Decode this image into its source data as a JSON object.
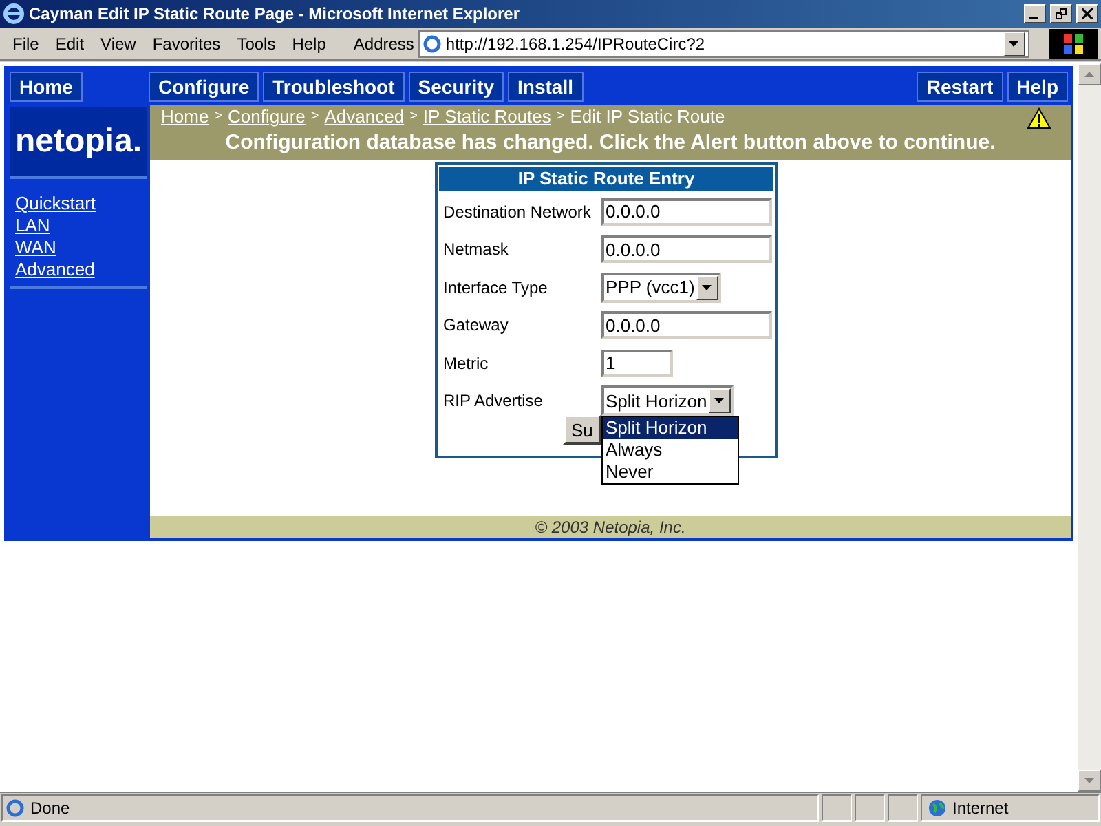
{
  "window": {
    "title": "Cayman Edit IP Static Route Page - Microsoft Internet Explorer"
  },
  "menu": [
    "File",
    "Edit",
    "View",
    "Favorites",
    "Tools",
    "Help"
  ],
  "address": {
    "label": "Address",
    "value": "http://192.168.1.254/IPRouteCirc?2"
  },
  "nav_left": [
    {
      "label": "Home"
    }
  ],
  "nav_main": [
    {
      "label": "Configure"
    },
    {
      "label": "Troubleshoot"
    },
    {
      "label": "Security"
    },
    {
      "label": "Install"
    }
  ],
  "nav_right": [
    {
      "label": "Restart"
    },
    {
      "label": "Help"
    }
  ],
  "logo": "netopia.",
  "sidebar": {
    "items": [
      {
        "label": "Quickstart"
      },
      {
        "label": "LAN"
      },
      {
        "label": "WAN"
      },
      {
        "label": "Advanced"
      }
    ]
  },
  "breadcrumb": [
    {
      "label": "Home",
      "link": true
    },
    {
      "label": "Configure",
      "link": true
    },
    {
      "label": "Advanced",
      "link": true
    },
    {
      "label": "IP Static Routes",
      "link": true
    },
    {
      "label": "Edit IP Static Route",
      "link": false
    }
  ],
  "breadcrumb_separator": ">",
  "alert": "Configuration database has changed. Click the Alert button above to continue.",
  "form": {
    "title": "IP Static Route Entry",
    "fields": [
      {
        "label": "Destination Network",
        "kind": "text",
        "value": "0.0.0.0"
      },
      {
        "label": "Netmask",
        "kind": "text",
        "value": "0.0.0.0"
      },
      {
        "label": "Interface Type",
        "kind": "select",
        "value": "PPP (vcc1)"
      },
      {
        "label": "Gateway",
        "kind": "text",
        "value": "0.0.0.0"
      },
      {
        "label": "Metric",
        "kind": "short",
        "value": "1"
      },
      {
        "label": "RIP Advertise",
        "kind": "select",
        "value": "Split Horizon",
        "expanded": true,
        "options": [
          {
            "label": "Split Horizon",
            "selected": true
          },
          {
            "label": "Always",
            "selected": false
          },
          {
            "label": "Never",
            "selected": false
          }
        ]
      }
    ],
    "submit": "Su"
  },
  "footer": "© 2003 Netopia, Inc.",
  "status_bar": {
    "text": "Done",
    "zone": "Internet"
  }
}
